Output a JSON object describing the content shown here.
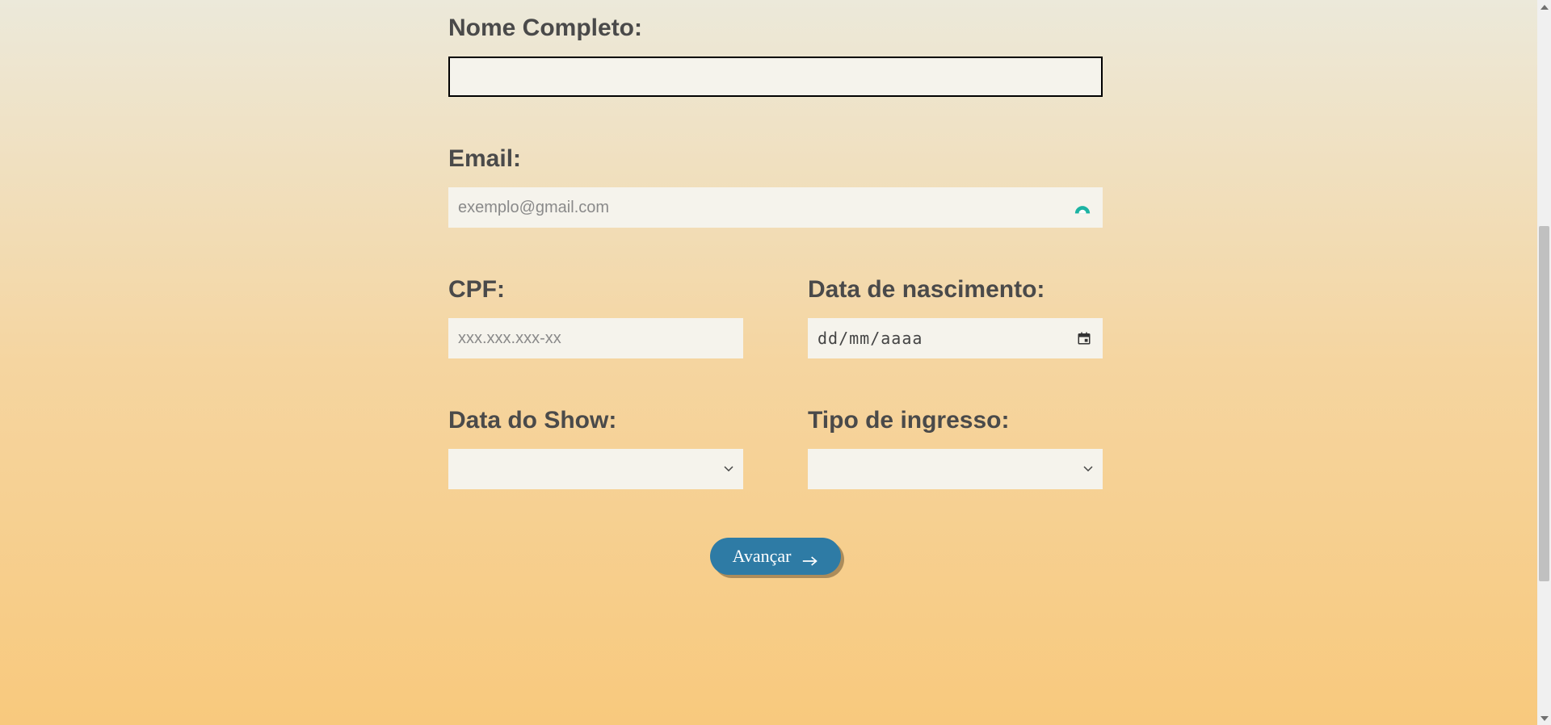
{
  "form": {
    "nome": {
      "label": "Nome Completo:",
      "value": "",
      "placeholder": ""
    },
    "email": {
      "label": "Email:",
      "value": "",
      "placeholder": "exemplo@gmail.com"
    },
    "cpf": {
      "label": "CPF:",
      "value": "",
      "placeholder": "xxx.xxx.xxx-xx"
    },
    "nascimento": {
      "label": "Data de nascimento:",
      "value": "dd/mm/aaaa"
    },
    "dataShow": {
      "label": "Data do Show:",
      "value": ""
    },
    "tipoIngresso": {
      "label": "Tipo de ingresso:",
      "value": ""
    },
    "submit": {
      "label": "Avançar"
    }
  },
  "colors": {
    "accent": "#2e7ba5",
    "badge": "#1cb3a3"
  }
}
